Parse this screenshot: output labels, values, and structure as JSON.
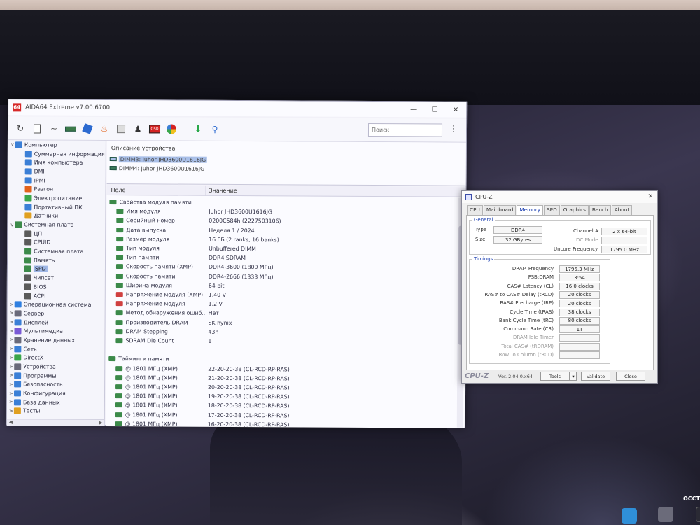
{
  "aida": {
    "title": "AIDA64 Extreme v7.00.6700",
    "search_placeholder": "Поиск",
    "tree": [
      {
        "label": "Компьютер",
        "level": 0,
        "exp": "v",
        "icon": "computer-icon",
        "color": "#3b7fd6"
      },
      {
        "label": "Суммарная информация",
        "level": 1,
        "exp": "",
        "icon": "summary-icon",
        "color": "#3b7fd6"
      },
      {
        "label": "Имя компьютера",
        "level": 1,
        "exp": "",
        "icon": "computer-name-icon",
        "color": "#3b7fd6"
      },
      {
        "label": "DMI",
        "level": 1,
        "exp": "",
        "icon": "dmi-icon",
        "color": "#3b7fd6"
      },
      {
        "label": "IPMI",
        "level": 1,
        "exp": "",
        "icon": "ipmi-icon",
        "color": "#3b7fd6"
      },
      {
        "label": "Разгон",
        "level": 1,
        "exp": "",
        "icon": "flame-icon",
        "color": "#e2621c"
      },
      {
        "label": "Электропитание",
        "level": 1,
        "exp": "",
        "icon": "power-icon",
        "color": "#3aa64a"
      },
      {
        "label": "Портативный ПК",
        "level": 1,
        "exp": "",
        "icon": "laptop-icon",
        "color": "#3b7fd6"
      },
      {
        "label": "Датчики",
        "level": 1,
        "exp": "",
        "icon": "sensor-icon",
        "color": "#e0a020"
      },
      {
        "label": "Системная плата",
        "level": 0,
        "exp": "v",
        "icon": "motherboard-icon",
        "color": "#3c8a4a"
      },
      {
        "label": "ЦП",
        "level": 1,
        "exp": "",
        "icon": "cpu-icon",
        "color": "#5a5a5a"
      },
      {
        "label": "CPUID",
        "level": 1,
        "exp": "",
        "icon": "cpuid-icon",
        "color": "#5a5a5a"
      },
      {
        "label": "Системная плата",
        "level": 1,
        "exp": "",
        "icon": "board-icon",
        "color": "#3c8a4a"
      },
      {
        "label": "Память",
        "level": 1,
        "exp": "",
        "icon": "memory-icon",
        "color": "#3c8a4a"
      },
      {
        "label": "SPD",
        "level": 1,
        "exp": "",
        "icon": "spd-icon",
        "color": "#3c8a4a",
        "selected": true
      },
      {
        "label": "Чипсет",
        "level": 1,
        "exp": "",
        "icon": "chipset-icon",
        "color": "#5a5a5a"
      },
      {
        "label": "BIOS",
        "level": 1,
        "exp": "",
        "icon": "bios-icon",
        "color": "#5a5a5a"
      },
      {
        "label": "ACPI",
        "level": 1,
        "exp": "",
        "icon": "acpi-icon",
        "color": "#5a5a5a"
      },
      {
        "label": "Операционная система",
        "level": 0,
        "exp": ">",
        "icon": "windows-icon",
        "color": "#2f7fe0"
      },
      {
        "label": "Сервер",
        "level": 0,
        "exp": ">",
        "icon": "server-icon",
        "color": "#6a6a7a"
      },
      {
        "label": "Дисплей",
        "level": 0,
        "exp": ">",
        "icon": "display-icon",
        "color": "#3b7fd6"
      },
      {
        "label": "Мультимедиа",
        "level": 0,
        "exp": ">",
        "icon": "multimedia-icon",
        "color": "#7a5ad6"
      },
      {
        "label": "Хранение данных",
        "level": 0,
        "exp": ">",
        "icon": "storage-icon",
        "color": "#6a6a7a"
      },
      {
        "label": "Сеть",
        "level": 0,
        "exp": ">",
        "icon": "network-icon",
        "color": "#3b7fd6"
      },
      {
        "label": "DirectX",
        "level": 0,
        "exp": ">",
        "icon": "directx-icon",
        "color": "#3aa64a"
      },
      {
        "label": "Устройства",
        "level": 0,
        "exp": ">",
        "icon": "devices-icon",
        "color": "#6a6a7a"
      },
      {
        "label": "Программы",
        "level": 0,
        "exp": ">",
        "icon": "programs-icon",
        "color": "#3b7fd6"
      },
      {
        "label": "Безопасность",
        "level": 0,
        "exp": ">",
        "icon": "security-icon",
        "color": "#3b7fd6"
      },
      {
        "label": "Конфигурация",
        "level": 0,
        "exp": ">",
        "icon": "config-icon",
        "color": "#3b7fd6"
      },
      {
        "label": "База данных",
        "level": 0,
        "exp": ">",
        "icon": "database-icon",
        "color": "#3b7fd6"
      },
      {
        "label": "Тесты",
        "level": 0,
        "exp": ">",
        "icon": "benchmark-icon",
        "color": "#e0a020"
      }
    ],
    "device_header": "Описание устройства",
    "devices": [
      {
        "label": "DIMM3: Juhor JHD3600U1616JG",
        "selected": true
      },
      {
        "label": "DIMM4: Juhor JHD3600U1616JG",
        "selected": false
      }
    ],
    "col_field": "Поле",
    "col_value": "Значение",
    "rows": [
      {
        "field": "Свойства модуля памяти",
        "value": "",
        "group": true,
        "icon": "memory-module-icon",
        "color": "#3c8a4a"
      },
      {
        "field": "Имя модуля",
        "value": "Juhor JHD3600U1616JG",
        "icon": "memory-module-icon",
        "color": "#3c8a4a"
      },
      {
        "field": "Серийный номер",
        "value": "0200C584h (2227503106)",
        "icon": "memory-module-icon",
        "color": "#3c8a4a"
      },
      {
        "field": "Дата выпуска",
        "value": "Неделя 1 / 2024",
        "icon": "memory-module-icon",
        "color": "#3c8a4a"
      },
      {
        "field": "Размер модуля",
        "value": "16 ГБ (2 ranks, 16 banks)",
        "icon": "memory-module-icon",
        "color": "#3c8a4a"
      },
      {
        "field": "Тип модуля",
        "value": "Unbuffered DIMM",
        "icon": "memory-module-icon",
        "color": "#3c8a4a"
      },
      {
        "field": "Тип памяти",
        "value": "DDR4 SDRAM",
        "icon": "memory-module-icon",
        "color": "#3c8a4a"
      },
      {
        "field": "Скорость памяти (XMP)",
        "value": "DDR4-3600 (1800 МГц)",
        "icon": "memory-module-icon",
        "color": "#3c8a4a"
      },
      {
        "field": "Скорость памяти",
        "value": "DDR4-2666 (1333 МГц)",
        "icon": "memory-module-icon",
        "color": "#3c8a4a"
      },
      {
        "field": "Ширина модуля",
        "value": "64 bit",
        "icon": "memory-module-icon",
        "color": "#3c8a4a"
      },
      {
        "field": "Напряжение модуля (XMP)",
        "value": "1.40 V",
        "icon": "voltage-icon",
        "color": "#d04040"
      },
      {
        "field": "Напряжение модуля",
        "value": "1.2 V",
        "icon": "voltage-icon",
        "color": "#d04040"
      },
      {
        "field": "Метод обнаружения ошиб...",
        "value": "Нет",
        "icon": "error-check-icon",
        "color": "#3c8a4a"
      },
      {
        "field": "Производитель DRAM",
        "value": "SK hynix",
        "icon": "memory-module-icon",
        "color": "#3c8a4a"
      },
      {
        "field": "DRAM Stepping",
        "value": "43h",
        "icon": "memory-module-icon",
        "color": "#3c8a4a"
      },
      {
        "field": "SDRAM Die Count",
        "value": "1",
        "icon": "memory-module-icon",
        "color": "#3c8a4a"
      },
      {
        "field": "",
        "value": "",
        "blank": true
      },
      {
        "field": "Тайминги памяти",
        "value": "",
        "group": true,
        "icon": "memory-module-icon",
        "color": "#3c8a4a"
      },
      {
        "field": "@ 1801 МГц (XMP)",
        "value": "22-20-20-38  (CL-RCD-RP-RAS)",
        "icon": "clock-icon",
        "color": "#3c8a4a"
      },
      {
        "field": "@ 1801 МГц (XMP)",
        "value": "21-20-20-38  (CL-RCD-RP-RAS)",
        "icon": "clock-icon",
        "color": "#3c8a4a"
      },
      {
        "field": "@ 1801 МГц (XMP)",
        "value": "20-20-20-38  (CL-RCD-RP-RAS)",
        "icon": "clock-icon",
        "color": "#3c8a4a"
      },
      {
        "field": "@ 1801 МГц (XMP)",
        "value": "19-20-20-38  (CL-RCD-RP-RAS)",
        "icon": "clock-icon",
        "color": "#3c8a4a"
      },
      {
        "field": "@ 1801 МГц (XMP)",
        "value": "18-20-20-38  (CL-RCD-RP-RAS)",
        "icon": "clock-icon",
        "color": "#3c8a4a"
      },
      {
        "field": "@ 1801 МГц (XMP)",
        "value": "17-20-20-38  (CL-RCD-RP-RAS)",
        "icon": "clock-icon",
        "color": "#3c8a4a"
      },
      {
        "field": "@ 1801 МГц (XMP)",
        "value": "16-20-20-38  (CL-RCD-RP-RAS)",
        "icon": "clock-icon",
        "color": "#3c8a4a"
      }
    ]
  },
  "cpuz": {
    "title": "CPU-Z",
    "tabs": [
      "CPU",
      "Mainboard",
      "Memory",
      "SPD",
      "Graphics",
      "Bench",
      "About"
    ],
    "active_tab": "Memory",
    "general_title": "General",
    "type_label": "Type",
    "type_value": "DDR4",
    "size_label": "Size",
    "size_value": "32 GBytes",
    "channel_label": "Channel #",
    "channel_value": "2 x 64-bit",
    "dc_mode_label": "DC Mode",
    "dc_mode_value": "",
    "uncore_label": "Uncore Frequency",
    "uncore_value": "1795.0 MHz",
    "timings_title": "Timings",
    "timings": [
      {
        "label": "DRAM Frequency",
        "value": "1795.3 MHz",
        "enabled": true
      },
      {
        "label": "FSB:DRAM",
        "value": "3:54",
        "enabled": true
      },
      {
        "label": "CAS# Latency (CL)",
        "value": "16.0 clocks",
        "enabled": true
      },
      {
        "label": "RAS# to CAS# Delay (tRCD)",
        "value": "20 clocks",
        "enabled": true
      },
      {
        "label": "RAS# Precharge (tRP)",
        "value": "20 clocks",
        "enabled": true
      },
      {
        "label": "Cycle Time (tRAS)",
        "value": "38 clocks",
        "enabled": true
      },
      {
        "label": "Bank Cycle Time (tRC)",
        "value": "80 clocks",
        "enabled": true
      },
      {
        "label": "Command Rate (CR)",
        "value": "1T",
        "enabled": true
      },
      {
        "label": "DRAM Idle Timer",
        "value": "",
        "enabled": false
      },
      {
        "label": "Total CAS# (tRDRAM)",
        "value": "",
        "enabled": false
      },
      {
        "label": "Row To Column (tRCD)",
        "value": "",
        "enabled": false
      }
    ],
    "brand": "CPU-Z",
    "version": "Ver. 2.04.0.x64",
    "tools_label": "Tools",
    "validate_label": "Validate",
    "close_label": "Close"
  },
  "desktop": {
    "occt_label": "OCCT"
  }
}
